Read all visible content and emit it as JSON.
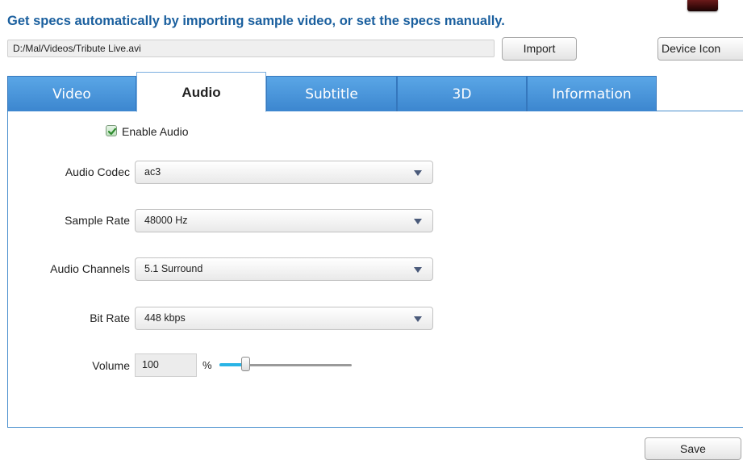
{
  "header": {
    "instruction": "Get specs automatically by importing sample video, or set the specs manually.",
    "path_value": "D:/Mal/Videos/Tribute Live.avi",
    "import_label": "Import",
    "device_icon_label": "Device Icon"
  },
  "tabs": [
    {
      "label": "Video",
      "active": false
    },
    {
      "label": "Audio",
      "active": true
    },
    {
      "label": "Subtitle",
      "active": false
    },
    {
      "label": "3D",
      "active": false
    },
    {
      "label": "Information",
      "active": false
    }
  ],
  "audio": {
    "enable_label": "Enable Audio",
    "enable_checked": true,
    "codec_label": "Audio Codec",
    "codec_value": "ac3",
    "sample_rate_label": "Sample Rate",
    "sample_rate_value": "48000 Hz",
    "channels_label": "Audio Channels",
    "channels_value": "5.1 Surround",
    "bit_rate_label": "Bit Rate",
    "bit_rate_value": "448 kbps",
    "volume_label": "Volume",
    "volume_value": "100",
    "volume_unit": "%",
    "volume_slider_fraction": 0.2
  },
  "footer": {
    "save_label": "Save"
  },
  "colors": {
    "accent": "#1a5f9e",
    "tab_blue": "#3c86cf",
    "slider_fill": "#2ab4e6",
    "checkbox_green": "#3a9a3a"
  }
}
